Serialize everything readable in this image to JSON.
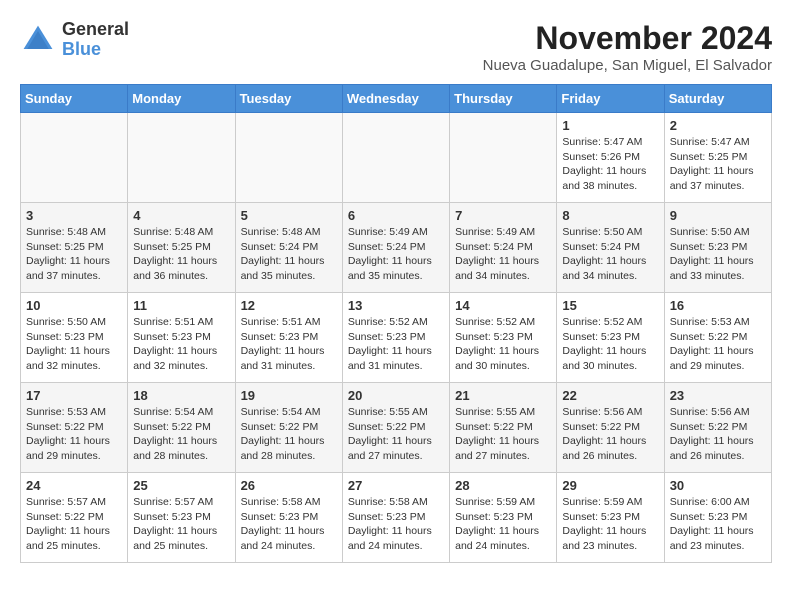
{
  "header": {
    "logo_general": "General",
    "logo_blue": "Blue",
    "month_year": "November 2024",
    "location": "Nueva Guadalupe, San Miguel, El Salvador"
  },
  "days_of_week": [
    "Sunday",
    "Monday",
    "Tuesday",
    "Wednesday",
    "Thursday",
    "Friday",
    "Saturday"
  ],
  "weeks": [
    [
      {
        "day": "",
        "info": ""
      },
      {
        "day": "",
        "info": ""
      },
      {
        "day": "",
        "info": ""
      },
      {
        "day": "",
        "info": ""
      },
      {
        "day": "",
        "info": ""
      },
      {
        "day": "1",
        "info": "Sunrise: 5:47 AM\nSunset: 5:26 PM\nDaylight: 11 hours\nand 38 minutes."
      },
      {
        "day": "2",
        "info": "Sunrise: 5:47 AM\nSunset: 5:25 PM\nDaylight: 11 hours\nand 37 minutes."
      }
    ],
    [
      {
        "day": "3",
        "info": "Sunrise: 5:48 AM\nSunset: 5:25 PM\nDaylight: 11 hours\nand 37 minutes."
      },
      {
        "day": "4",
        "info": "Sunrise: 5:48 AM\nSunset: 5:25 PM\nDaylight: 11 hours\nand 36 minutes."
      },
      {
        "day": "5",
        "info": "Sunrise: 5:48 AM\nSunset: 5:24 PM\nDaylight: 11 hours\nand 35 minutes."
      },
      {
        "day": "6",
        "info": "Sunrise: 5:49 AM\nSunset: 5:24 PM\nDaylight: 11 hours\nand 35 minutes."
      },
      {
        "day": "7",
        "info": "Sunrise: 5:49 AM\nSunset: 5:24 PM\nDaylight: 11 hours\nand 34 minutes."
      },
      {
        "day": "8",
        "info": "Sunrise: 5:50 AM\nSunset: 5:24 PM\nDaylight: 11 hours\nand 34 minutes."
      },
      {
        "day": "9",
        "info": "Sunrise: 5:50 AM\nSunset: 5:23 PM\nDaylight: 11 hours\nand 33 minutes."
      }
    ],
    [
      {
        "day": "10",
        "info": "Sunrise: 5:50 AM\nSunset: 5:23 PM\nDaylight: 11 hours\nand 32 minutes."
      },
      {
        "day": "11",
        "info": "Sunrise: 5:51 AM\nSunset: 5:23 PM\nDaylight: 11 hours\nand 32 minutes."
      },
      {
        "day": "12",
        "info": "Sunrise: 5:51 AM\nSunset: 5:23 PM\nDaylight: 11 hours\nand 31 minutes."
      },
      {
        "day": "13",
        "info": "Sunrise: 5:52 AM\nSunset: 5:23 PM\nDaylight: 11 hours\nand 31 minutes."
      },
      {
        "day": "14",
        "info": "Sunrise: 5:52 AM\nSunset: 5:23 PM\nDaylight: 11 hours\nand 30 minutes."
      },
      {
        "day": "15",
        "info": "Sunrise: 5:52 AM\nSunset: 5:23 PM\nDaylight: 11 hours\nand 30 minutes."
      },
      {
        "day": "16",
        "info": "Sunrise: 5:53 AM\nSunset: 5:22 PM\nDaylight: 11 hours\nand 29 minutes."
      }
    ],
    [
      {
        "day": "17",
        "info": "Sunrise: 5:53 AM\nSunset: 5:22 PM\nDaylight: 11 hours\nand 29 minutes."
      },
      {
        "day": "18",
        "info": "Sunrise: 5:54 AM\nSunset: 5:22 PM\nDaylight: 11 hours\nand 28 minutes."
      },
      {
        "day": "19",
        "info": "Sunrise: 5:54 AM\nSunset: 5:22 PM\nDaylight: 11 hours\nand 28 minutes."
      },
      {
        "day": "20",
        "info": "Sunrise: 5:55 AM\nSunset: 5:22 PM\nDaylight: 11 hours\nand 27 minutes."
      },
      {
        "day": "21",
        "info": "Sunrise: 5:55 AM\nSunset: 5:22 PM\nDaylight: 11 hours\nand 27 minutes."
      },
      {
        "day": "22",
        "info": "Sunrise: 5:56 AM\nSunset: 5:22 PM\nDaylight: 11 hours\nand 26 minutes."
      },
      {
        "day": "23",
        "info": "Sunrise: 5:56 AM\nSunset: 5:22 PM\nDaylight: 11 hours\nand 26 minutes."
      }
    ],
    [
      {
        "day": "24",
        "info": "Sunrise: 5:57 AM\nSunset: 5:22 PM\nDaylight: 11 hours\nand 25 minutes."
      },
      {
        "day": "25",
        "info": "Sunrise: 5:57 AM\nSunset: 5:23 PM\nDaylight: 11 hours\nand 25 minutes."
      },
      {
        "day": "26",
        "info": "Sunrise: 5:58 AM\nSunset: 5:23 PM\nDaylight: 11 hours\nand 24 minutes."
      },
      {
        "day": "27",
        "info": "Sunrise: 5:58 AM\nSunset: 5:23 PM\nDaylight: 11 hours\nand 24 minutes."
      },
      {
        "day": "28",
        "info": "Sunrise: 5:59 AM\nSunset: 5:23 PM\nDaylight: 11 hours\nand 24 minutes."
      },
      {
        "day": "29",
        "info": "Sunrise: 5:59 AM\nSunset: 5:23 PM\nDaylight: 11 hours\nand 23 minutes."
      },
      {
        "day": "30",
        "info": "Sunrise: 6:00 AM\nSunset: 5:23 PM\nDaylight: 11 hours\nand 23 minutes."
      }
    ]
  ]
}
